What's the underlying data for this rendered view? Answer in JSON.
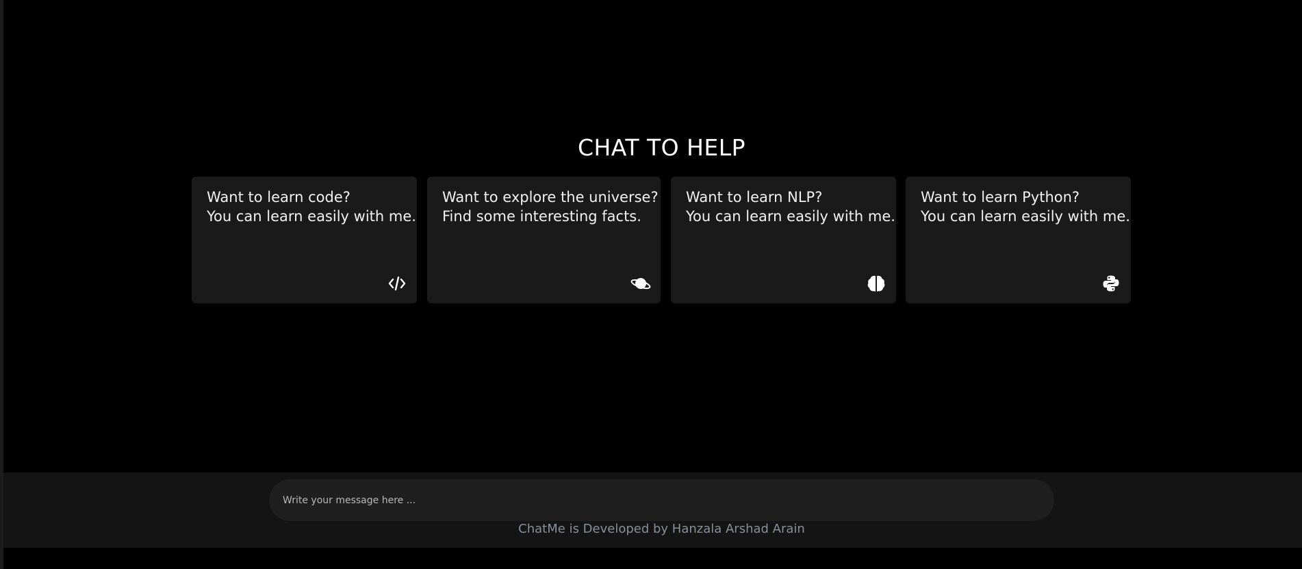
{
  "page": {
    "title": "CHAT TO HELP"
  },
  "cards": [
    {
      "line1": "Want to learn code?",
      "line2": "You can learn easily with me.",
      "icon": "code-icon"
    },
    {
      "line1": "Want to explore the universe?",
      "line2": "Find some interesting facts.",
      "icon": "planet-icon"
    },
    {
      "line1": "Want to learn NLP?",
      "line2": "You can learn easily with me.",
      "icon": "brain-icon"
    },
    {
      "line1": "Want to learn Python?",
      "line2": "You can learn easily with me.",
      "icon": "python-icon"
    }
  ],
  "composer": {
    "placeholder": "Write your message here ..."
  },
  "footer": {
    "credit": "ChatMe is Developed by Hanzala Arshad Arain"
  },
  "colors": {
    "background": "#000000",
    "card": "#1a1a1a",
    "footer": "#141414",
    "input": "#1f1f1f",
    "credit_text": "#8a8f99"
  }
}
